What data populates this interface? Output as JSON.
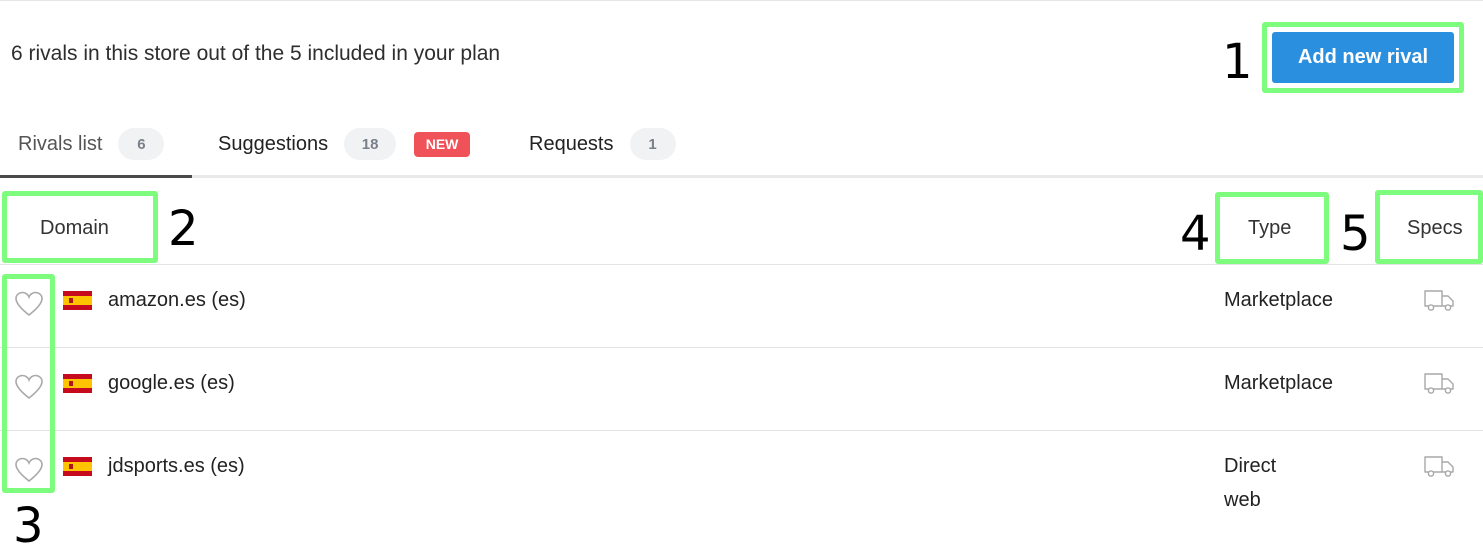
{
  "summary": "6 rivals in this store out of the 5 included in your plan",
  "add_button": {
    "label": "Add new rival"
  },
  "annotations": [
    "1",
    "2",
    "3",
    "4",
    "5"
  ],
  "tabs": [
    {
      "label": "Rivals list",
      "count": "6",
      "active": true
    },
    {
      "label": "Suggestions",
      "count": "18",
      "badge": "NEW"
    },
    {
      "label": "Requests",
      "count": "1"
    }
  ],
  "columns": {
    "domain": "Domain",
    "type": "Type",
    "specs": "Specs"
  },
  "rows": [
    {
      "domain": "amazon.es (es)",
      "type": "Marketplace",
      "favorite": false,
      "flag": "spain-flag-icon",
      "spec_icon": "truck-icon"
    },
    {
      "domain": "google.es (es)",
      "type": "Marketplace",
      "favorite": false,
      "flag": "spain-flag-icon",
      "spec_icon": "truck-icon"
    },
    {
      "domain": "jdsports.es (es)",
      "type": "Direct web",
      "favorite": false,
      "flag": "spain-flag-icon",
      "spec_icon": "truck-icon"
    }
  ],
  "colors": {
    "primary_button": "#2b8fe0",
    "highlight_box": "#7dfc7d",
    "new_badge": "#f0525a"
  }
}
